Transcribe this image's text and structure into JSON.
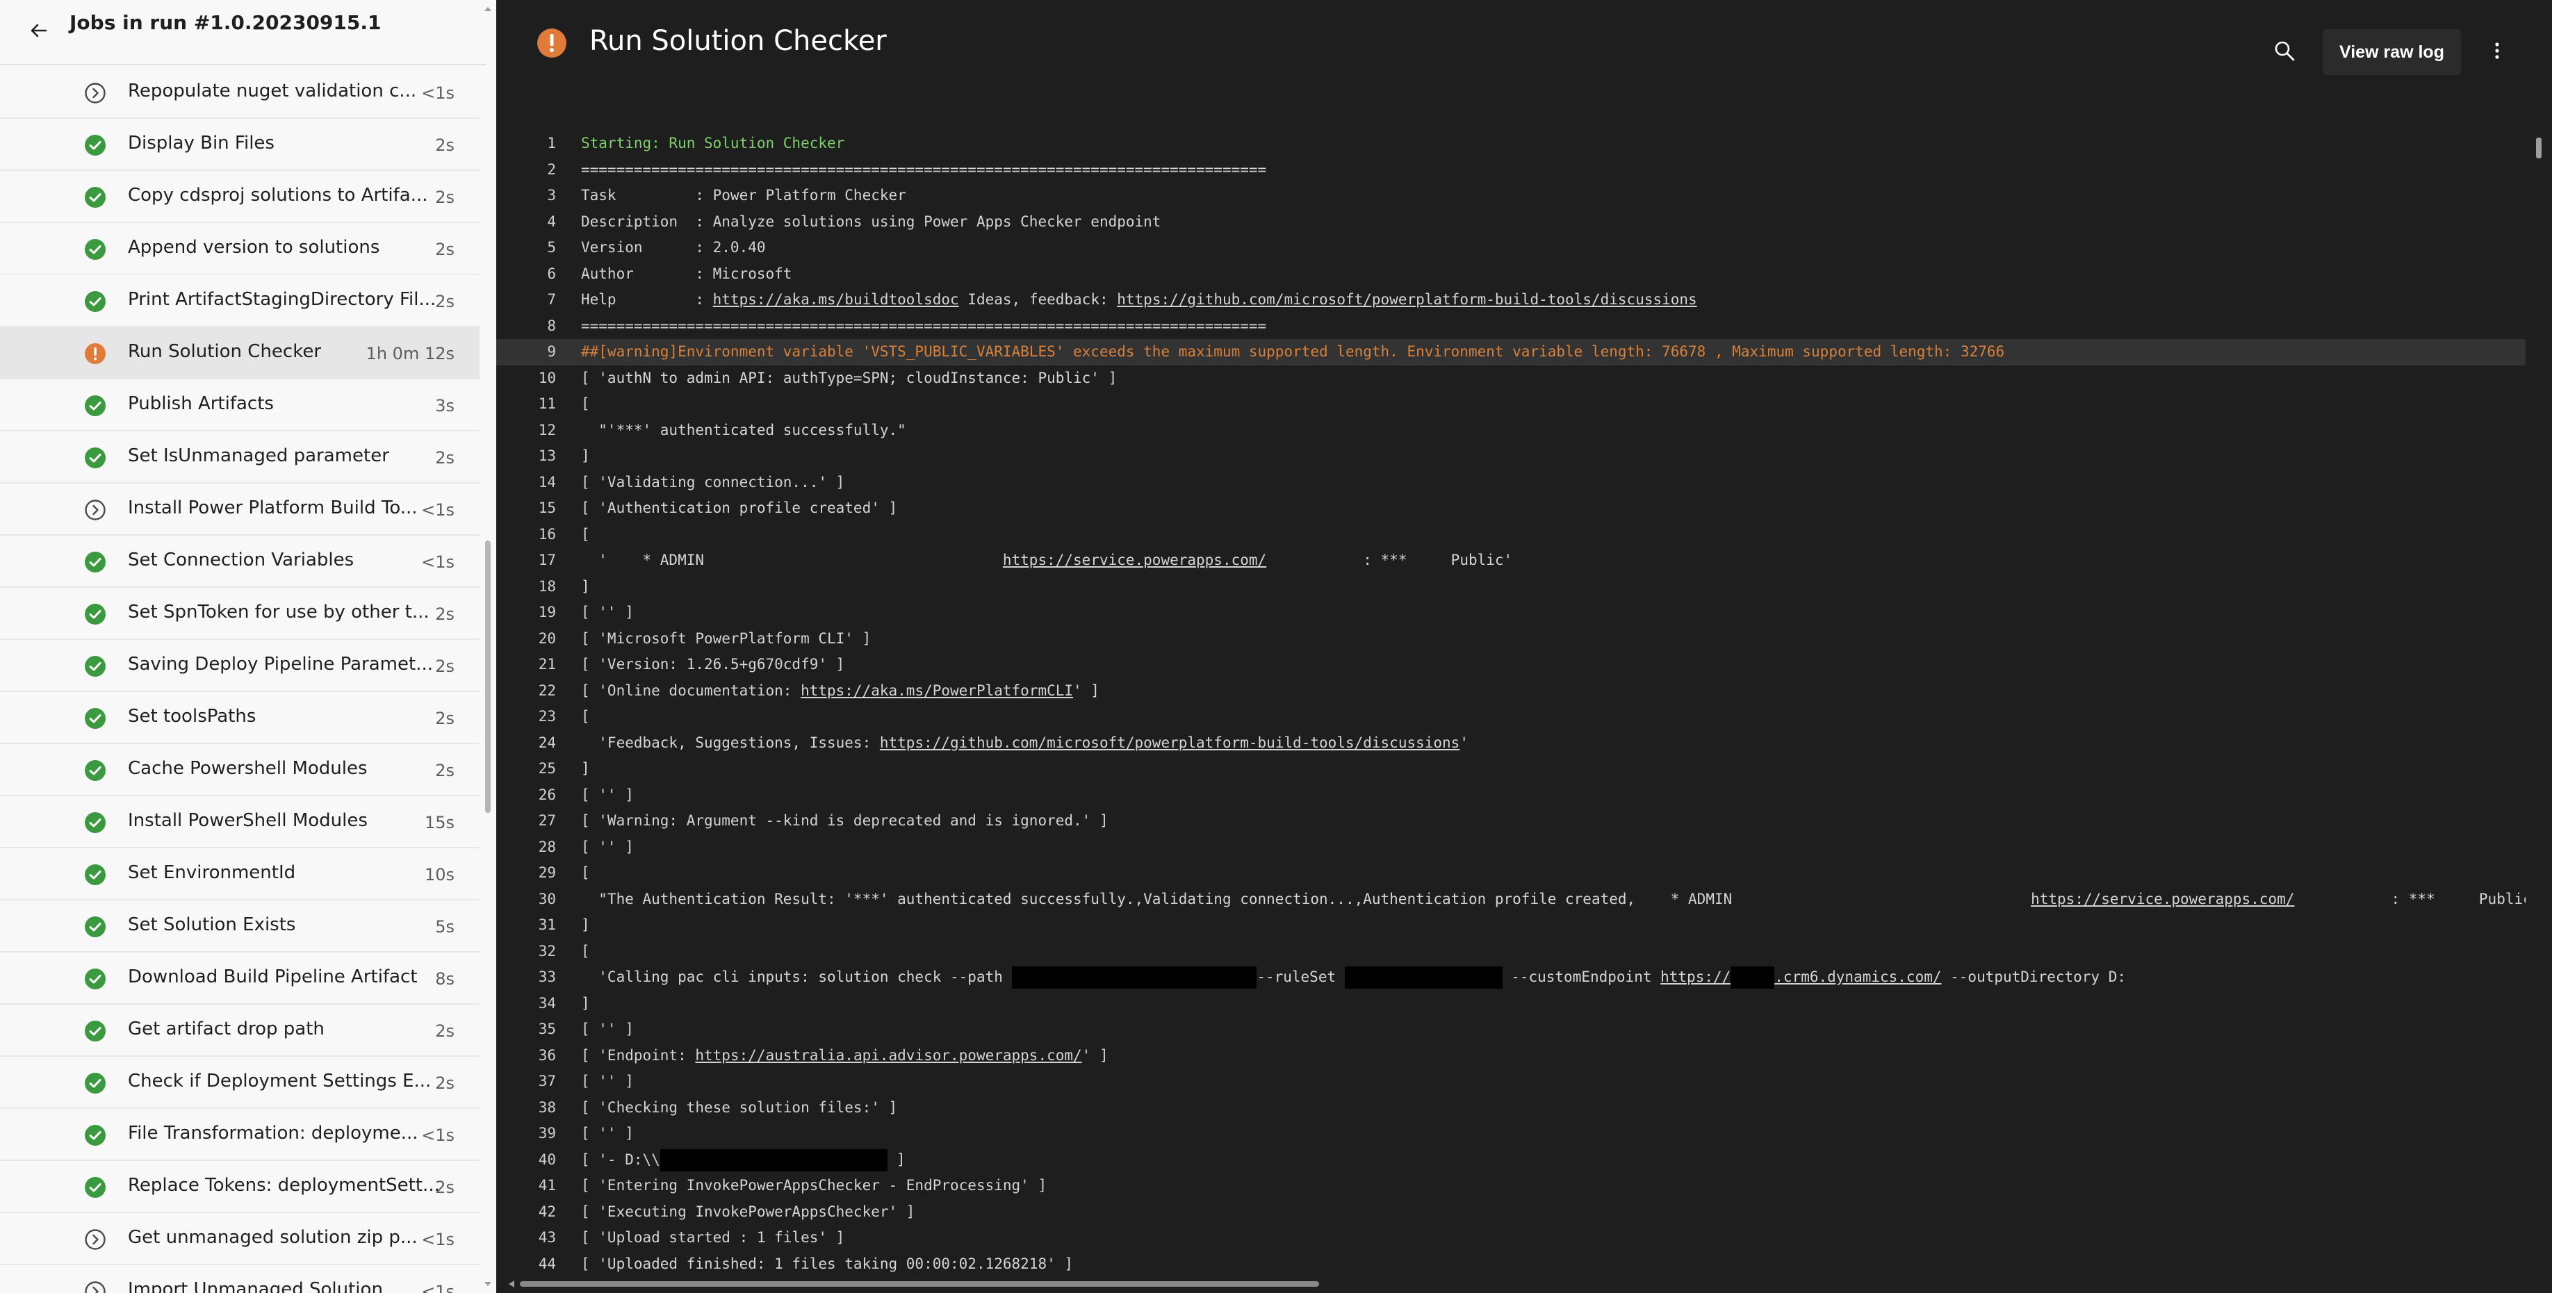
{
  "sidebar": {
    "title": "Jobs in run #1.0.20230915.1",
    "jobs": [
      {
        "name": "Repopulate nuget validation c...",
        "duration": "<1s",
        "status": "skipped"
      },
      {
        "name": "Display Bin Files",
        "duration": "2s",
        "status": "success"
      },
      {
        "name": "Copy cdsproj solutions to Artifa...",
        "duration": "2s",
        "status": "success"
      },
      {
        "name": "Append version to solutions",
        "duration": "2s",
        "status": "success"
      },
      {
        "name": "Print ArtifactStagingDirectory Fil...",
        "duration": "2s",
        "status": "success"
      },
      {
        "name": "Run Solution Checker",
        "duration": "1h 0m 12s",
        "status": "warning",
        "selected": true
      },
      {
        "name": "Publish Artifacts",
        "duration": "3s",
        "status": "success"
      },
      {
        "name": "Set IsUnmanaged parameter",
        "duration": "2s",
        "status": "success"
      },
      {
        "name": "Install Power Platform Build To...",
        "duration": "<1s",
        "status": "skipped"
      },
      {
        "name": "Set Connection Variables",
        "duration": "<1s",
        "status": "success"
      },
      {
        "name": "Set SpnToken for use by other t...",
        "duration": "2s",
        "status": "success"
      },
      {
        "name": "Saving Deploy Pipeline Paramet...",
        "duration": "2s",
        "status": "success"
      },
      {
        "name": "Set toolsPaths",
        "duration": "2s",
        "status": "success"
      },
      {
        "name": "Cache Powershell Modules",
        "duration": "2s",
        "status": "success"
      },
      {
        "name": "Install PowerShell Modules",
        "duration": "15s",
        "status": "success"
      },
      {
        "name": "Set EnvironmentId",
        "duration": "10s",
        "status": "success"
      },
      {
        "name": "Set Solution Exists",
        "duration": "5s",
        "status": "success"
      },
      {
        "name": "Download Build Pipeline Artifact",
        "duration": "8s",
        "status": "success"
      },
      {
        "name": "Get artifact drop path",
        "duration": "2s",
        "status": "success"
      },
      {
        "name": "Check if Deployment Settings E...",
        "duration": "2s",
        "status": "success"
      },
      {
        "name": "File Transformation: deployme...",
        "duration": "<1s",
        "status": "success"
      },
      {
        "name": "Replace Tokens: deploymentSett...",
        "duration": "2s",
        "status": "success"
      },
      {
        "name": "Get unmanaged solution zip p...",
        "duration": "<1s",
        "status": "skipped"
      },
      {
        "name": "Import Unmanaged Solution",
        "duration": "<1s",
        "status": "skipped"
      }
    ]
  },
  "log": {
    "title": "Run Solution Checker",
    "view_raw_label": "View raw log",
    "lines": [
      {
        "n": "1",
        "style": "green",
        "parts": [
          {
            "t": "Starting: Run Solution Checker"
          }
        ]
      },
      {
        "n": "2",
        "parts": [
          {
            "t": "=============================================================================="
          }
        ]
      },
      {
        "n": "3",
        "parts": [
          {
            "t": "Task         : Power Platform Checker"
          }
        ]
      },
      {
        "n": "4",
        "parts": [
          {
            "t": "Description  : Analyze solutions using Power Apps Checker endpoint"
          }
        ]
      },
      {
        "n": "5",
        "parts": [
          {
            "t": "Version      : 2.0.40"
          }
        ]
      },
      {
        "n": "6",
        "parts": [
          {
            "t": "Author       : Microsoft"
          }
        ]
      },
      {
        "n": "7",
        "parts": [
          {
            "t": "Help         : "
          },
          {
            "t": "https://aka.ms/buildtoolsdoc",
            "link": true
          },
          {
            "t": " Ideas, feedback: "
          },
          {
            "t": "https://github.com/microsoft/powerplatform-build-tools/discussions",
            "link": true
          }
        ]
      },
      {
        "n": "8",
        "parts": [
          {
            "t": "=============================================================================="
          }
        ]
      },
      {
        "n": "9",
        "style": "warn",
        "highlight": true,
        "parts": [
          {
            "t": "##[warning]Environment variable 'VSTS_PUBLIC_VARIABLES' exceeds the maximum supported length. Environment variable length: 76678 , Maximum supported length: 32766"
          }
        ]
      },
      {
        "n": "10",
        "parts": [
          {
            "t": "[ 'authN to admin API: authType=SPN; cloudInstance: Public' ]"
          }
        ]
      },
      {
        "n": "11",
        "parts": [
          {
            "t": "["
          }
        ]
      },
      {
        "n": "12",
        "parts": [
          {
            "t": "  \"'***' authenticated successfully.\""
          }
        ]
      },
      {
        "n": "13",
        "parts": [
          {
            "t": "]"
          }
        ]
      },
      {
        "n": "14",
        "parts": [
          {
            "t": "[ 'Validating connection...' ]"
          }
        ]
      },
      {
        "n": "15",
        "parts": [
          {
            "t": "[ 'Authentication profile created' ]"
          }
        ]
      },
      {
        "n": "16",
        "parts": [
          {
            "t": "["
          }
        ]
      },
      {
        "n": "17",
        "parts": [
          {
            "t": "  '    * ADMIN                                  "
          },
          {
            "t": "https://service.powerapps.com/",
            "link": true
          },
          {
            "t": "           : ***     Public'"
          }
        ]
      },
      {
        "n": "18",
        "parts": [
          {
            "t": "]"
          }
        ]
      },
      {
        "n": "19",
        "parts": [
          {
            "t": "[ '' ]"
          }
        ]
      },
      {
        "n": "20",
        "parts": [
          {
            "t": "[ 'Microsoft PowerPlatform CLI' ]"
          }
        ]
      },
      {
        "n": "21",
        "parts": [
          {
            "t": "[ 'Version: 1.26.5+g670cdf9' ]"
          }
        ]
      },
      {
        "n": "22",
        "parts": [
          {
            "t": "[ 'Online documentation: "
          },
          {
            "t": "https://aka.ms/PowerPlatformCLI",
            "link": true
          },
          {
            "t": "' ]"
          }
        ]
      },
      {
        "n": "23",
        "parts": [
          {
            "t": "["
          }
        ]
      },
      {
        "n": "24",
        "parts": [
          {
            "t": "  'Feedback, Suggestions, Issues: "
          },
          {
            "t": "https://github.com/microsoft/powerplatform-build-tools/discussions",
            "link": true
          },
          {
            "t": "'"
          }
        ]
      },
      {
        "n": "25",
        "parts": [
          {
            "t": "]"
          }
        ]
      },
      {
        "n": "26",
        "parts": [
          {
            "t": "[ '' ]"
          }
        ]
      },
      {
        "n": "27",
        "parts": [
          {
            "t": "[ 'Warning: Argument --kind is deprecated and is ignored.' ]"
          }
        ]
      },
      {
        "n": "28",
        "parts": [
          {
            "t": "[ '' ]"
          }
        ]
      },
      {
        "n": "29",
        "parts": [
          {
            "t": "["
          }
        ]
      },
      {
        "n": "30",
        "parts": [
          {
            "t": "  \"The Authentication Result: '***' authenticated successfully.,Validating connection...,Authentication profile created,    * ADMIN                                  "
          },
          {
            "t": "https://service.powerapps.com/",
            "link": true
          },
          {
            "t": "           : ***     Public,,N"
          }
        ]
      },
      {
        "n": "31",
        "parts": [
          {
            "t": "]"
          }
        ]
      },
      {
        "n": "32",
        "parts": [
          {
            "t": "["
          }
        ]
      },
      {
        "n": "33",
        "parts": [
          {
            "t": "  'Calling pac cli inputs: solution check --path "
          },
          {
            "redact": 28
          },
          {
            "t": "--ruleSet "
          },
          {
            "redact": 18
          },
          {
            "t": " --customEndpoint "
          },
          {
            "t": "https://",
            "link": true
          },
          {
            "redact": 5
          },
          {
            "t": ".crm6.dynamics.com/",
            "link": true
          },
          {
            "t": " --outputDirectory D:"
          }
        ]
      },
      {
        "n": "34",
        "parts": [
          {
            "t": "]"
          }
        ]
      },
      {
        "n": "35",
        "parts": [
          {
            "t": "[ '' ]"
          }
        ]
      },
      {
        "n": "36",
        "parts": [
          {
            "t": "[ 'Endpoint: "
          },
          {
            "t": "https://australia.api.advisor.powerapps.com/",
            "link": true
          },
          {
            "t": "' ]"
          }
        ]
      },
      {
        "n": "37",
        "parts": [
          {
            "t": "[ '' ]"
          }
        ]
      },
      {
        "n": "38",
        "parts": [
          {
            "t": "[ 'Checking these solution files:' ]"
          }
        ]
      },
      {
        "n": "39",
        "parts": [
          {
            "t": "[ '' ]"
          }
        ]
      },
      {
        "n": "40",
        "parts": [
          {
            "t": "[ '- D:\\\\"
          },
          {
            "redact": 26
          },
          {
            "t": " ]"
          }
        ]
      },
      {
        "n": "41",
        "parts": [
          {
            "t": "[ 'Entering InvokePowerAppsChecker - EndProcessing' ]"
          }
        ]
      },
      {
        "n": "42",
        "parts": [
          {
            "t": "[ 'Executing InvokePowerAppsChecker' ]"
          }
        ]
      },
      {
        "n": "43",
        "parts": [
          {
            "t": "[ 'Upload started : 1 files' ]"
          }
        ]
      },
      {
        "n": "44",
        "parts": [
          {
            "t": "[ 'Uploaded finished: 1 files taking 00:00:02.1268218' ]"
          }
        ]
      }
    ]
  },
  "colors": {
    "success": "#3b9a3f",
    "warning": "#e07b39",
    "log_green": "#7fcf6a",
    "log_warning": "#d8813a"
  },
  "icons": {
    "back": "arrow-left-icon",
    "success": "check-circle-icon",
    "skipped": "chevron-right-circle-icon",
    "warning": "exclamation-circle-icon",
    "search": "search-icon",
    "more": "more-vertical-icon"
  }
}
